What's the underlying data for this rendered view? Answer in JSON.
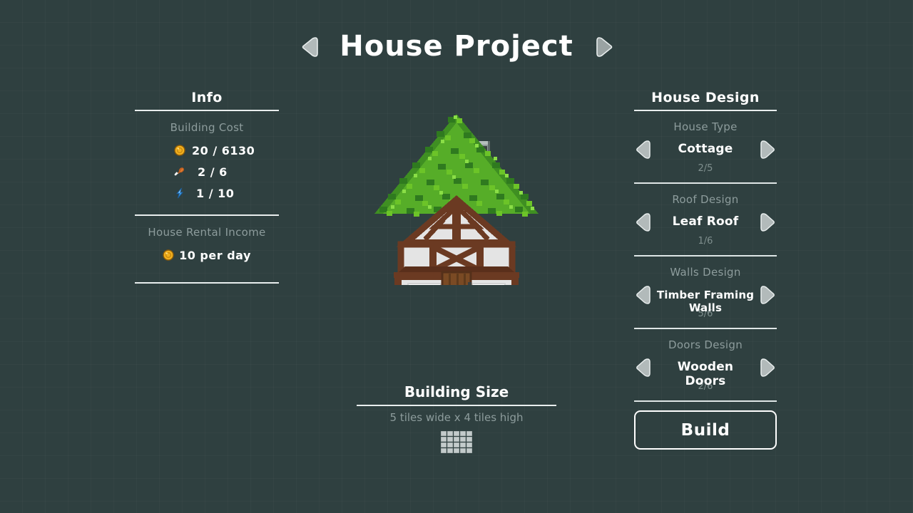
{
  "header": {
    "title": "House Project",
    "prev_icon": "left-arrow-icon",
    "next_icon": "right-arrow-icon"
  },
  "info_panel": {
    "title": "Info",
    "building_cost_label": "Building Cost",
    "costs": [
      {
        "icon": "coin-icon",
        "text": "20 / 6130"
      },
      {
        "icon": "food-icon",
        "text": "2 / 6"
      },
      {
        "icon": "energy-icon",
        "text": "1 / 10"
      }
    ],
    "rental_label": "House Rental Income",
    "rental": {
      "icon": "coin-icon",
      "text": "10 per day"
    }
  },
  "design_panel": {
    "title": "House Design",
    "groups": [
      {
        "label": "House Type",
        "value": "Cottage",
        "counter": "2/5"
      },
      {
        "label": "Roof Design",
        "value": "Leaf Roof",
        "counter": "1/6"
      },
      {
        "label": "Walls Design",
        "value": "Timber Framing Walls",
        "counter": "5/6"
      },
      {
        "label": "Doors Design",
        "value": "Wooden Doors",
        "counter": "2/6"
      }
    ],
    "build_label": "Build"
  },
  "building_size": {
    "title": "Building Size",
    "description": "5 tiles wide x 4 tiles high",
    "tiles_wide": 5,
    "tiles_high": 4
  },
  "preview": {
    "name": "house-preview",
    "alt": "Cottage with leaf roof, timber framing walls and wooden doors"
  },
  "colors": {
    "background": "#2f4040",
    "text": "#ffffff",
    "muted": "#8d9c9c",
    "arrow": "#b8c0c0",
    "coin": "#f2b01e",
    "food": "#c4601f",
    "energy": "#3d9ae8",
    "leaf_light": "#6cc428",
    "leaf_dark": "#2f7a1f",
    "timber": "#6b3a22",
    "plaster": "#e4e4e4",
    "door": "#7a4a24",
    "window": "#2f6f9e"
  }
}
